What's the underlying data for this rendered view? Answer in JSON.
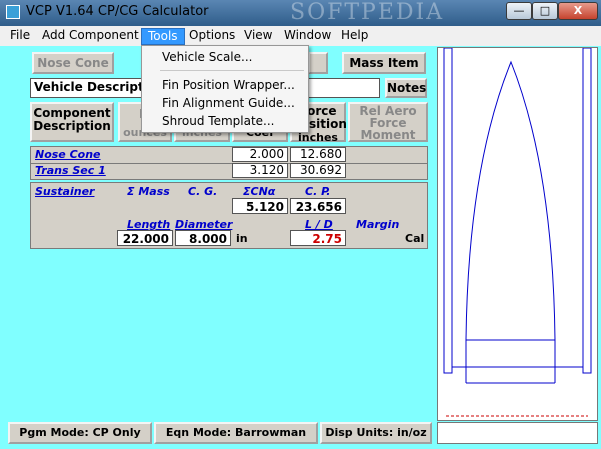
{
  "window": {
    "title": "VCP V1.64 CP/CG Calculator",
    "watermark": "SOFTPEDIA",
    "minimize": "—",
    "maximize": "□",
    "close": "X"
  },
  "menubar": [
    "File",
    "Add Component",
    "Tools",
    "Options",
    "View",
    "Window",
    "Help"
  ],
  "tools_menu": {
    "items": [
      "Vehicle Scale...",
      "Fin Position Wrapper...",
      "Fin Alignment Guide...",
      "Shroud Template..."
    ]
  },
  "toolbar": {
    "nose_cone": "Nose Cone",
    "mass_item": "Mass Item",
    "vehicle_description": "Vehicle Description",
    "notes": "Notes"
  },
  "headers": {
    "component_description": "Component Description",
    "col2_partial": "M",
    "col2_sub": "ounces",
    "col3_sub": "inches",
    "col4_sub": "Coef",
    "force_position": "Force Position",
    "force_position_unit": "inches",
    "rel_aero_force_moment": "Rel Aero Force Moment"
  },
  "rows": [
    {
      "name": "Nose Cone",
      "coef": "2.000",
      "position": "12.680"
    },
    {
      "name": "Trans Sec 1",
      "coef": "3.120",
      "position": "30.692"
    }
  ],
  "sustainer": {
    "label": "Sustainer",
    "sum_mass_label": "Σ Mass",
    "cg_label": "C. G.",
    "sum_cn_label": "ΣCNα",
    "cp_label": "C. P.",
    "sum_cn_value": "5.120",
    "cp_value": "23.656",
    "length_label": "Length",
    "diameter_label": "Diameter",
    "ld_label": "L / D",
    "margin_label": "Margin",
    "length_value": "22.000",
    "diameter_value": "8.000",
    "unit_in": "in",
    "ld_value": "2.75",
    "cal": "Cal"
  },
  "status": {
    "pgm_mode": "Pgm Mode: CP Only",
    "eqn_mode": "Eqn Mode: Barrowman",
    "disp_units": "Disp Units: in/oz"
  },
  "colors": {
    "client_bg": "#80ffff",
    "menu_highlight": "#3399ff",
    "link_blue": "#0000cc",
    "ld_red": "#cc0000",
    "outline_blue": "#0000cc"
  }
}
